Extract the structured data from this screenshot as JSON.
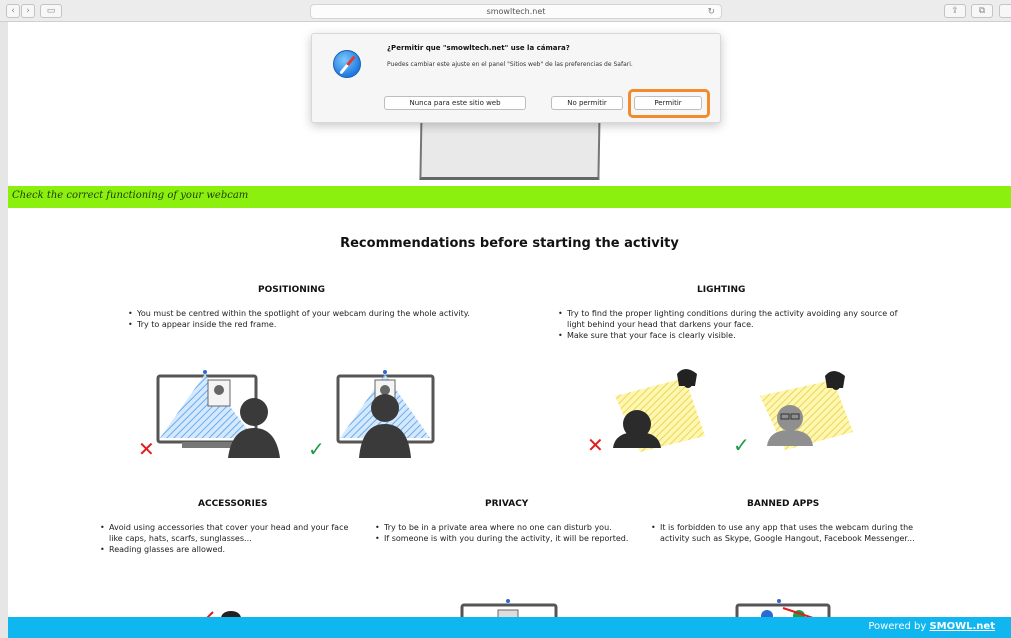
{
  "browser": {
    "url": "smowltech.net",
    "back_glyph": "‹",
    "forward_glyph": "›",
    "sidebar_glyph": "▭",
    "reload_glyph": "↻",
    "share_glyph": "⇪",
    "tabs_glyph": "⧉"
  },
  "dialog": {
    "title": "¿Permitir que \"smowltech.net\" use la cámara?",
    "message": "Puedes cambiar este ajuste en el panel \"Sitios web\" de las preferencias de Safari.",
    "never_label": "Nunca para este sitio web",
    "deny_label": "No permitir",
    "allow_label": "Permitir",
    "highlight_color": "#f08c2e"
  },
  "banner": {
    "text": "Check the correct functioning of your webcam",
    "color": "#8bf00e"
  },
  "main": {
    "title": "Recommendations before starting the activity"
  },
  "sections": {
    "positioning": {
      "title": "POSITIONING",
      "items": [
        "You must be centred within the spotlight of your webcam during the whole activity.",
        "Try to appear inside the red frame."
      ]
    },
    "lighting": {
      "title": "LIGHTING",
      "items": [
        "Try to find the proper lighting conditions during the activity avoiding any source of light behind your head that darkens your face.",
        "Make sure that your face is clearly visible."
      ]
    },
    "accessories": {
      "title": "ACCESSORIES",
      "items": [
        "Avoid using accessories that cover your head and your face like caps, hats, scarfs, sunglasses...",
        "Reading glasses are allowed."
      ]
    },
    "privacy": {
      "title": "PRIVACY",
      "items": [
        "Try to be in a private area where no one can disturb you.",
        "If someone is with you during the activity, it will be reported."
      ]
    },
    "banned_apps": {
      "title": "BANNED APPS",
      "items": [
        "It is forbidden to use any app that uses the webcam during the activity such as Skype, Google Hangout, Facebook Messenger..."
      ]
    }
  },
  "footer": {
    "prefix": "Powered by ",
    "brand": "SMOWL.net",
    "color": "#0fb6ef"
  }
}
